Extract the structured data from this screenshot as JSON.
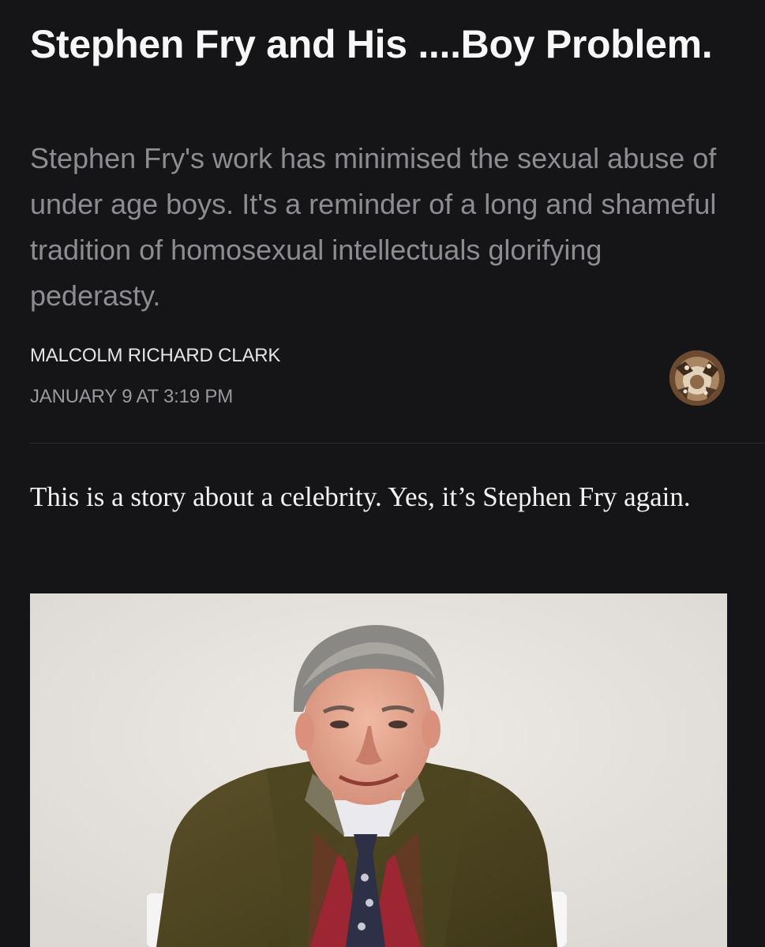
{
  "article": {
    "title": "Stephen Fry and His ....Boy Problem.",
    "subtitle": "Stephen Fry's work has minimised the sexual abuse of under age boys. It's a reminder of a long and shameful tradition of homosexual intellectuals glorifying pederasty.",
    "author": "MALCOLM RICHARD CLARK",
    "date": "JANUARY 9 AT 3:19 PM",
    "lead_paragraph": "This is a story about a celebrity. Yes, it’s Stephen Fry again."
  },
  "icons": {
    "author_avatar": "avatar-icon"
  },
  "colors": {
    "background": "#151517",
    "title": "#f7f7f7",
    "subtitle": "#8d8d91",
    "meta": "#9a9a9e",
    "body_text": "#f2f2f2",
    "photo_background": "#e6e3df"
  }
}
